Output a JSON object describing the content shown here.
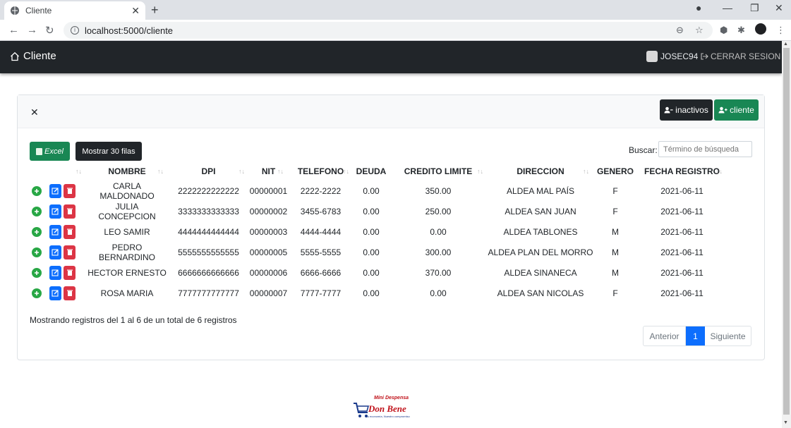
{
  "browser": {
    "tab_title": "Cliente",
    "url": "localhost:5000/cliente"
  },
  "navbar": {
    "brand": "Cliente",
    "username": "JOSEC94",
    "logout": "CERRAR SESION"
  },
  "card": {
    "btn_inactivos": "inactivos",
    "btn_cliente": "cliente"
  },
  "toolbar": {
    "excel": "Excel",
    "show_rows": "Mostrar 30 filas",
    "search_label": "Buscar:",
    "search_placeholder": "Término de búsqueda"
  },
  "table": {
    "headers": [
      "",
      "NOMBRE",
      "DPI",
      "NIT",
      "TELEFONO",
      "DEUDA",
      "CREDITO LIMITE",
      "DIRECCION",
      "GENERO",
      "FECHA REGISTRO"
    ],
    "rows": [
      {
        "nombre": "CARLA MALDONADO",
        "dpi": "2222222222222",
        "nit": "00000001",
        "telefono": "2222-2222",
        "deuda": "0.00",
        "credito": "350.00",
        "direccion": "ALDEA MAL PAÍS",
        "genero": "F",
        "fecha": "2021-06-11"
      },
      {
        "nombre": "JULIA CONCEPCION",
        "dpi": "3333333333333",
        "nit": "00000002",
        "telefono": "3455-6783",
        "deuda": "0.00",
        "credito": "250.00",
        "direccion": "ALDEA SAN JUAN",
        "genero": "F",
        "fecha": "2021-06-11"
      },
      {
        "nombre": "LEO SAMIR",
        "dpi": "4444444444444",
        "nit": "00000003",
        "telefono": "4444-4444",
        "deuda": "0.00",
        "credito": "0.00",
        "direccion": "ALDEA TABLONES",
        "genero": "M",
        "fecha": "2021-06-11"
      },
      {
        "nombre": "PEDRO BERNARDINO",
        "dpi": "5555555555555",
        "nit": "00000005",
        "telefono": "5555-5555",
        "deuda": "0.00",
        "credito": "300.00",
        "direccion": "ALDEA PLAN DEL MORRO",
        "genero": "M",
        "fecha": "2021-06-11"
      },
      {
        "nombre": "HECTOR ERNESTO",
        "dpi": "6666666666666",
        "nit": "00000006",
        "telefono": "6666-6666",
        "deuda": "0.00",
        "credito": "370.00",
        "direccion": "ALDEA SINANECA",
        "genero": "M",
        "fecha": "2021-06-11"
      },
      {
        "nombre": "ROSA MARIA",
        "dpi": "7777777777777",
        "nit": "00000007",
        "telefono": "7777-7777",
        "deuda": "0.00",
        "credito": "0.00",
        "direccion": "ALDEA SAN NICOLAS",
        "genero": "F",
        "fecha": "2021-06-11"
      }
    ]
  },
  "footer": {
    "info": "Mostrando registros del 1 al 6 de un total de 6 registros",
    "prev": "Anterior",
    "current_page": "1",
    "next": "Siguiente"
  },
  "logo": {
    "line1": "Mini Despensa",
    "line2": "Don Bene",
    "line3": "Su economía, Nuestro compromiso"
  },
  "colors": {
    "navbar": "#212529",
    "green": "#198754",
    "blue": "#0d6efd",
    "red": "#dc3545"
  }
}
